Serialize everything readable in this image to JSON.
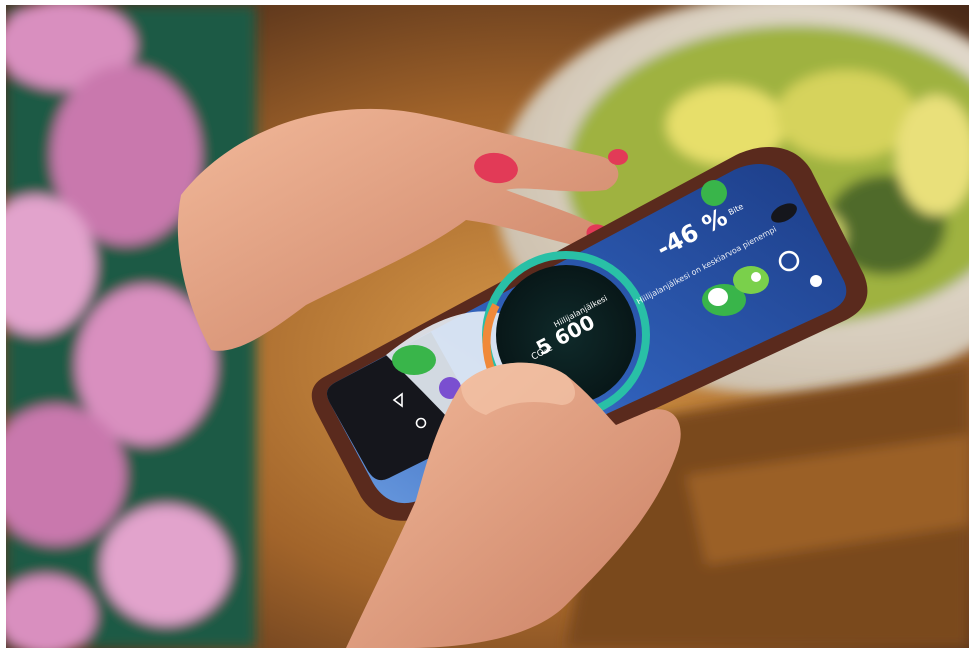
{
  "photo": {
    "subject": "hands holding smartphone showing carbon footprint app",
    "colors": {
      "background_warm": "#c98a3e",
      "floral_green": "#1f5a45",
      "floral_pink": "#d98fbf",
      "salad": "#b9c94a",
      "skin": "#e9a98c",
      "nail": "#e23a57",
      "phone_body": "#5a2a1d",
      "screen_blue": "#2f5fb8",
      "ring_teal": "#29c0a6",
      "ring_orange": "#f0893a",
      "app_green": "#39b54a"
    }
  },
  "app": {
    "percent": "-46 %",
    "percent_caption": "Hiilijalanjälkesi on keskiarvoa pienempi",
    "circle_label": "Hiilijalanjälkesi",
    "circle_value": "5 600",
    "circle_unit": "CO₂e",
    "status_label": "Bite",
    "icons": [
      "leaf-icon",
      "settings-gear-icon",
      "sun-icon",
      "mascot-icon"
    ]
  },
  "nav": {
    "buttons": [
      "back-icon",
      "home-icon",
      "recents-icon"
    ]
  }
}
